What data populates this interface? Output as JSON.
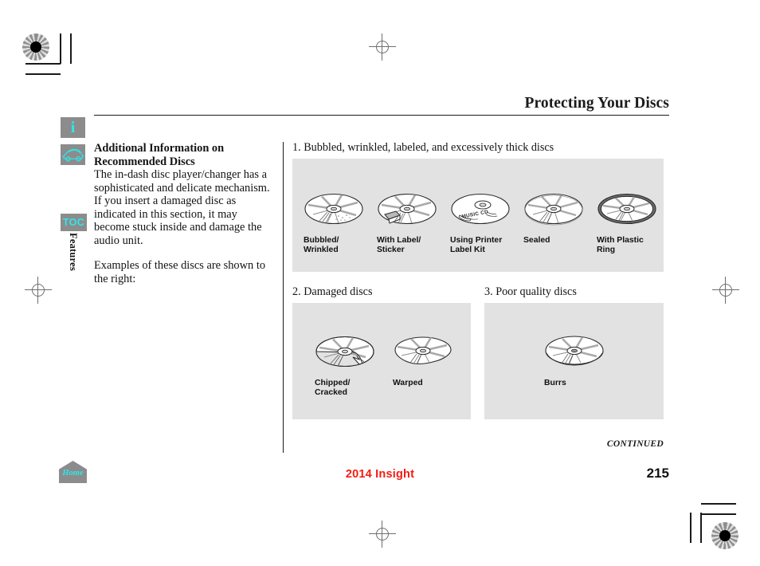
{
  "document": {
    "title": "Protecting Your Discs",
    "section_tab": "Features",
    "footer_model": "2014 Insight",
    "page_number": "215",
    "continued": "CONTINUED"
  },
  "rail": {
    "info_icon": "info-icon",
    "info_glyph": "i",
    "car_icon": "car-icon",
    "toc_label": "TOC",
    "home_label": "Home"
  },
  "left_column": {
    "heading_line1": "Additional Information on",
    "heading_line2": "Recommended Discs",
    "paragraph1": "The in-dash disc player/changer has a sophisticated and delicate mechanism. If you insert a damaged disc as indicated in this section, it may become stuck inside and damage the audio unit.",
    "paragraph2": "Examples of these discs are shown to the right:"
  },
  "figures": [
    {
      "id": "fig1",
      "caption": "1. Bubbled, wrinkled, labeled, and excessively thick discs",
      "discs": [
        {
          "name": "bubbled-wrinkled-disc",
          "label": "Bubbled/\nWrinkled",
          "variant": "bubbled"
        },
        {
          "name": "with-label-sticker-disc",
          "label": "With Label/\nSticker",
          "variant": "sticker"
        },
        {
          "name": "printer-label-kit-disc",
          "label": "Using Printer\nLabel Kit",
          "variant": "printed",
          "print_text": "MUSIC CD"
        },
        {
          "name": "sealed-disc",
          "label": "Sealed",
          "variant": "sealed"
        },
        {
          "name": "with-plastic-ring-disc",
          "label": "With Plastic\nRing",
          "variant": "ring"
        }
      ]
    },
    {
      "id": "fig2",
      "caption": "2. Damaged discs",
      "discs": [
        {
          "name": "chipped-cracked-disc",
          "label": "Chipped/\nCracked",
          "variant": "chipped"
        },
        {
          "name": "warped-disc",
          "label": "Warped",
          "variant": "warped"
        }
      ]
    },
    {
      "id": "fig3",
      "caption": "3. Poor quality discs",
      "discs": [
        {
          "name": "burrs-disc",
          "label": "Burrs",
          "variant": "burrs"
        }
      ]
    }
  ],
  "colors": {
    "accent_cyan": "#2ce8ec",
    "footer_red": "#f61a12",
    "figure_bg": "#e2e2e2",
    "rail_gray": "#8c8c8c",
    "ink": "#131313"
  }
}
